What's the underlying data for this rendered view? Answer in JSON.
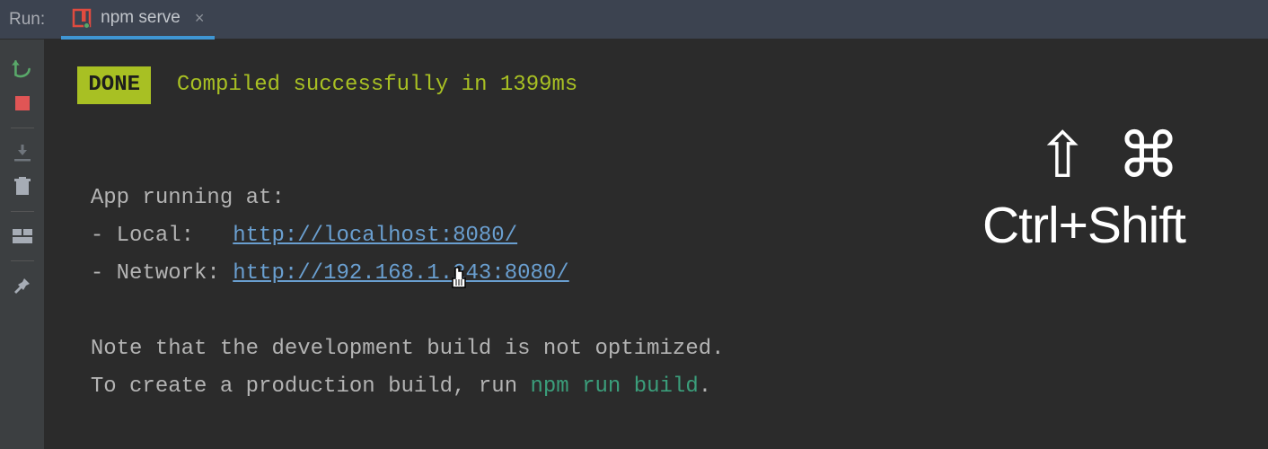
{
  "header": {
    "run_label": "Run:"
  },
  "tab": {
    "label": "npm serve",
    "close": "×"
  },
  "console": {
    "done_badge": "DONE",
    "done_message": "Compiled successfully in 1399ms",
    "app_running": "App running at:",
    "local_prefix": "- Local:   ",
    "local_url": "http://localhost:8080/",
    "network_prefix": "- Network: ",
    "network_url": "http://192.168.1.243:8080/",
    "note_line1": "Note that the development build is not optimized.",
    "note_line2_pre": "To create a production build, run ",
    "note_cmd": "npm run build",
    "note_line2_post": "."
  },
  "overlay": {
    "symbols": "⇧ ⌘",
    "text": "Ctrl+Shift"
  }
}
